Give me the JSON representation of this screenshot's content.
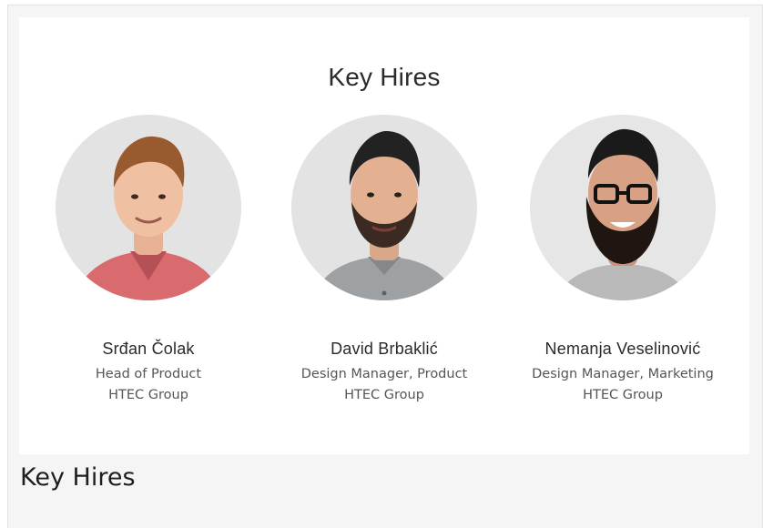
{
  "section": {
    "title": "Key Hires",
    "caption": "Key Hires"
  },
  "people": [
    {
      "name": "Srđan Čolak",
      "role": "Head of Product",
      "company": "HTEC Group",
      "shirt_color": "#d96a6e",
      "avatar": "person-photo"
    },
    {
      "name": "David Brbaklić",
      "role": "Design Manager, Product",
      "company": "HTEC Group",
      "shirt_color": "#9ea1a4",
      "avatar": "person-photo"
    },
    {
      "name": "Nemanja Veselinović",
      "role": "Design Manager, Marketing",
      "company": "HTEC Group",
      "shirt_color": "#b9b9b9",
      "avatar": "person-photo"
    }
  ],
  "colors": {
    "page_bg": "#f5f5f5",
    "card_bg": "#ffffff",
    "avatar_bg": "#e3e3e3",
    "text_dark": "#2a2a2a",
    "text_muted": "#555555"
  }
}
